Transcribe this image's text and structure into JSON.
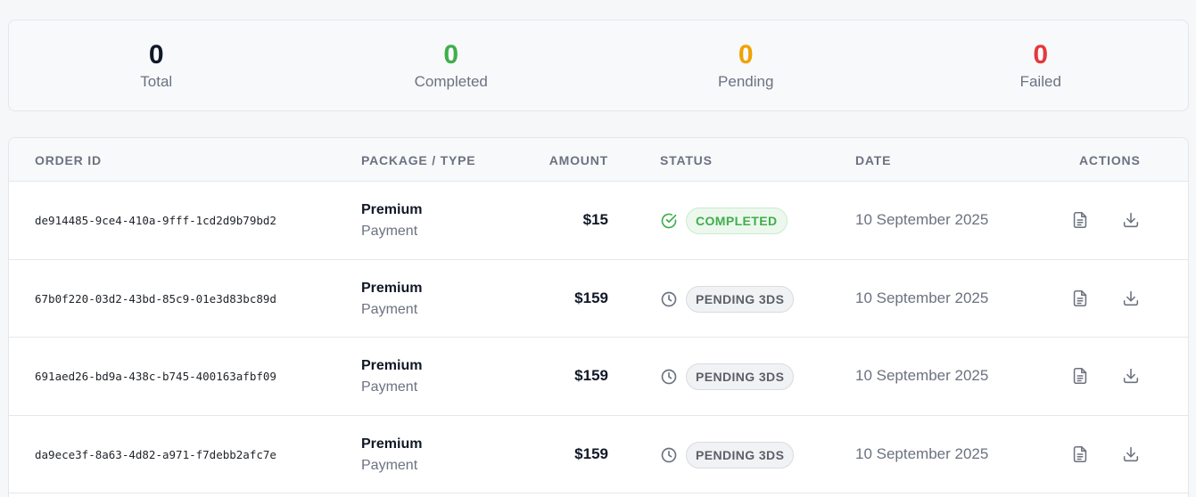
{
  "stats": [
    {
      "value": "0",
      "label": "Total",
      "color": "#111827"
    },
    {
      "value": "0",
      "label": "Completed",
      "color": "#3fae4a"
    },
    {
      "value": "0",
      "label": "Pending",
      "color": "#f0a202"
    },
    {
      "value": "0",
      "label": "Failed",
      "color": "#e5383b"
    }
  ],
  "table": {
    "headers": {
      "order_id": "ORDER ID",
      "package": "PACKAGE / TYPE",
      "amount": "AMOUNT",
      "status": "STATUS",
      "date": "DATE",
      "actions": "ACTIONS"
    },
    "rows": [
      {
        "order_id": "de914485-9ce4-410a-9fff-1cd2d9b79bd2",
        "package": "Premium",
        "type": "Payment",
        "amount": "$15",
        "status": "COMPLETED",
        "status_kind": "completed",
        "status_icon": "check-circle-icon",
        "date": "10 September 2025"
      },
      {
        "order_id": "67b0f220-03d2-43bd-85c9-01e3d83bc89d",
        "package": "Premium",
        "type": "Payment",
        "amount": "$159",
        "status": "PENDING 3DS",
        "status_kind": "pending",
        "status_icon": "clock-icon",
        "date": "10 September 2025"
      },
      {
        "order_id": "691aed26-bd9a-438c-b745-400163afbf09",
        "package": "Premium",
        "type": "Payment",
        "amount": "$159",
        "status": "PENDING 3DS",
        "status_kind": "pending",
        "status_icon": "clock-icon",
        "date": "10 September 2025"
      },
      {
        "order_id": "da9ece3f-8a63-4d82-a971-f7debb2afc7e",
        "package": "Premium",
        "type": "Payment",
        "amount": "$159",
        "status": "PENDING 3DS",
        "status_kind": "pending",
        "status_icon": "clock-icon",
        "date": "10 September 2025"
      }
    ]
  }
}
